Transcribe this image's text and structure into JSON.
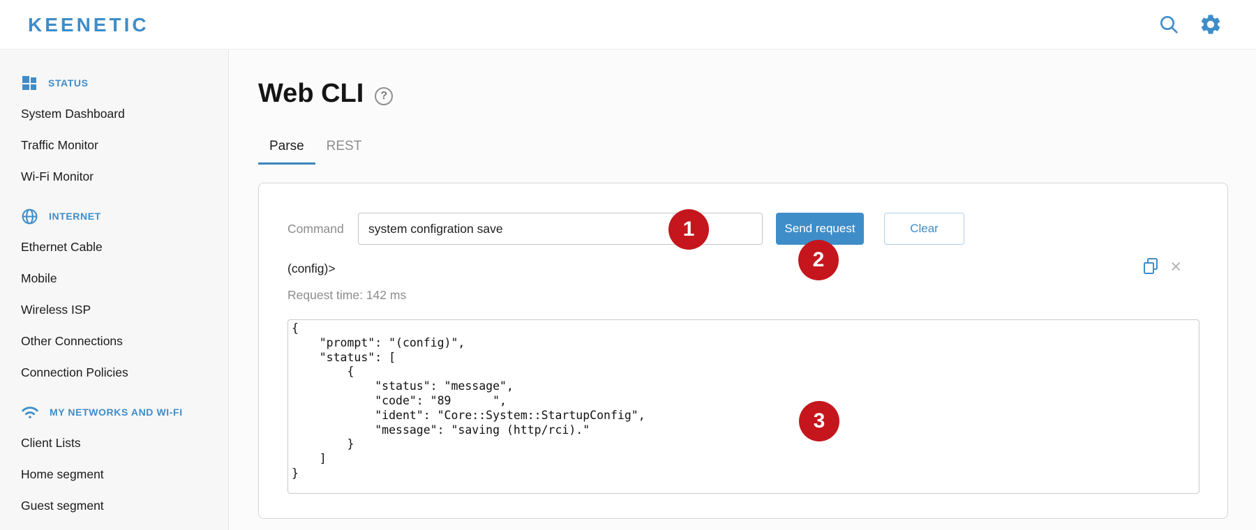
{
  "colors": {
    "accent_blue": "#3e8dc9",
    "marker_red": "#c4161c",
    "active_tab_underline": "#3e86bd"
  },
  "header": {
    "logo_text": "KEENETIC",
    "search_icon": "search-icon",
    "settings_icon": "gear-icon"
  },
  "sidebar": {
    "sections": [
      {
        "label": "STATUS",
        "icon": "dashboard-grid-icon",
        "items": [
          "System Dashboard",
          "Traffic Monitor",
          "Wi-Fi Monitor"
        ]
      },
      {
        "label": "INTERNET",
        "icon": "globe-icon",
        "items": [
          "Ethernet Cable",
          "Mobile",
          "Wireless ISP",
          "Other Connections",
          "Connection Policies"
        ]
      },
      {
        "label": "MY NETWORKS AND WI-FI",
        "icon": "wifi-icon",
        "items": [
          "Client Lists",
          "Home segment",
          "Guest segment"
        ]
      }
    ]
  },
  "main": {
    "title": "Web CLI",
    "help_icon": "?",
    "tabs": [
      {
        "label": "Parse",
        "active": true
      },
      {
        "label": "REST",
        "active": false
      }
    ],
    "command_label": "Command",
    "command_value": "system configration save",
    "send_button_label": "Send request",
    "clear_button_label": "Clear",
    "prompt_text": "(config)>",
    "request_time_text": "Request time: 142 ms",
    "close_icon": "×",
    "output_json": "{\n    \"prompt\": \"(config)\",\n    \"status\": [\n        {\n            \"status\": \"message\",\n            \"code\": \"89      \",\n            \"ident\": \"Core::System::StartupConfig\",\n            \"message\": \"saving (http/rci).\"\n        }\n    ]\n}"
  },
  "annotations": [
    {
      "number": "1"
    },
    {
      "number": "2"
    },
    {
      "number": "3"
    }
  ]
}
